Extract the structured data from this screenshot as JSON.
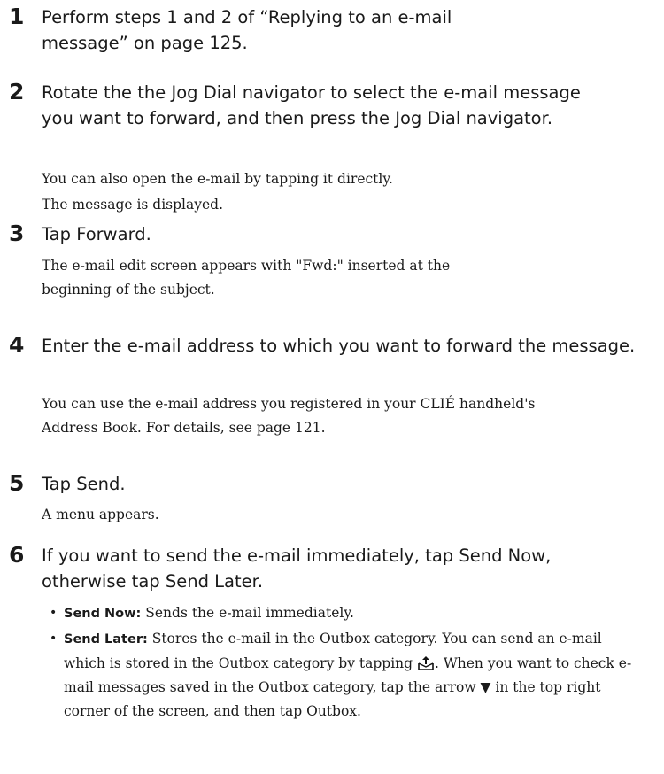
{
  "steps": [
    {
      "number": "1",
      "heading": "Perform steps 1 and 2 of “Replying to an e-mail message” on page 125.",
      "details": []
    },
    {
      "number": "2",
      "heading": "Rotate the the Jog Dial navigator to select the e-mail message you want to forward, and then press the Jog Dial navigator.",
      "details": [
        "You can also open the e-mail by tapping it directly.",
        "The message is displayed."
      ]
    },
    {
      "number": "3",
      "heading": "Tap Forward.",
      "details": [
        "The e-mail edit screen appears with \"Fwd:\" inserted at the beginning of the subject."
      ]
    },
    {
      "number": "4",
      "heading": "Enter the e-mail address to which you want to forward the message.",
      "details": [
        "You can use the e-mail address you registered in your CLIÉ handheld's Address Book. For details, see page 121."
      ]
    },
    {
      "number": "5",
      "heading": "Tap Send.",
      "details": [
        "A menu appears."
      ]
    },
    {
      "number": "6",
      "heading": "If you want to send the e-mail immediately, tap Send Now, otherwise tap Send Later.",
      "details": []
    }
  ],
  "options": [
    {
      "label": "Send Now:",
      "text": " Sends the e-mail immediately."
    },
    {
      "label": "Send Later:",
      "text_before_icon": " Stores the e-mail in the Outbox category. You can send an e-mail which is stored in the Outbox category by tapping ",
      "icon": "outbox-send-icon",
      "text_after_icon": ". When you want to check e-mail messages saved in the Outbox category, tap the arrow ▼ in the top right corner of the screen, and then tap Outbox."
    }
  ]
}
